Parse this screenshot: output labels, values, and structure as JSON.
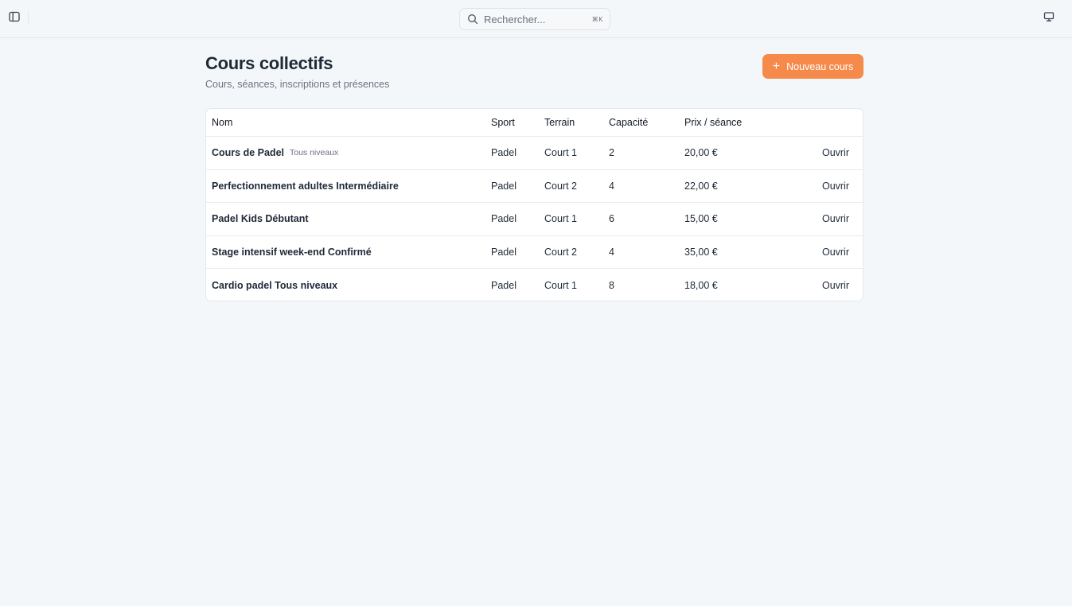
{
  "topbar": {
    "search_placeholder": "Rechercher...",
    "search_shortcut": "⌘K"
  },
  "header": {
    "title": "Cours collectifs",
    "subtitle": "Cours, séances, inscriptions et présences",
    "new_button_label": "Nouveau cours"
  },
  "colors": {
    "accent": "#f58a4b",
    "background": "#f4f7fa"
  },
  "table": {
    "columns": {
      "name": "Nom",
      "sport": "Sport",
      "terrain": "Terrain",
      "capacity": "Capacité",
      "price": "Prix / séance"
    },
    "rows": [
      {
        "name": "Cours de Padel",
        "level": "Tous niveaux",
        "sport": "Padel",
        "terrain": "Court 1",
        "capacity": "2",
        "price": "20,00 €",
        "action": "Ouvrir"
      },
      {
        "name": "Perfectionnement adultes Intermédiaire",
        "level": "",
        "sport": "Padel",
        "terrain": "Court 2",
        "capacity": "4",
        "price": "22,00 €",
        "action": "Ouvrir"
      },
      {
        "name": "Padel Kids Débutant",
        "level": "",
        "sport": "Padel",
        "terrain": "Court 1",
        "capacity": "6",
        "price": "15,00 €",
        "action": "Ouvrir"
      },
      {
        "name": "Stage intensif week-end Confirmé",
        "level": "",
        "sport": "Padel",
        "terrain": "Court 2",
        "capacity": "4",
        "price": "35,00 €",
        "action": "Ouvrir"
      },
      {
        "name": "Cardio padel Tous niveaux",
        "level": "",
        "sport": "Padel",
        "terrain": "Court 1",
        "capacity": "8",
        "price": "18,00 €",
        "action": "Ouvrir"
      }
    ]
  }
}
